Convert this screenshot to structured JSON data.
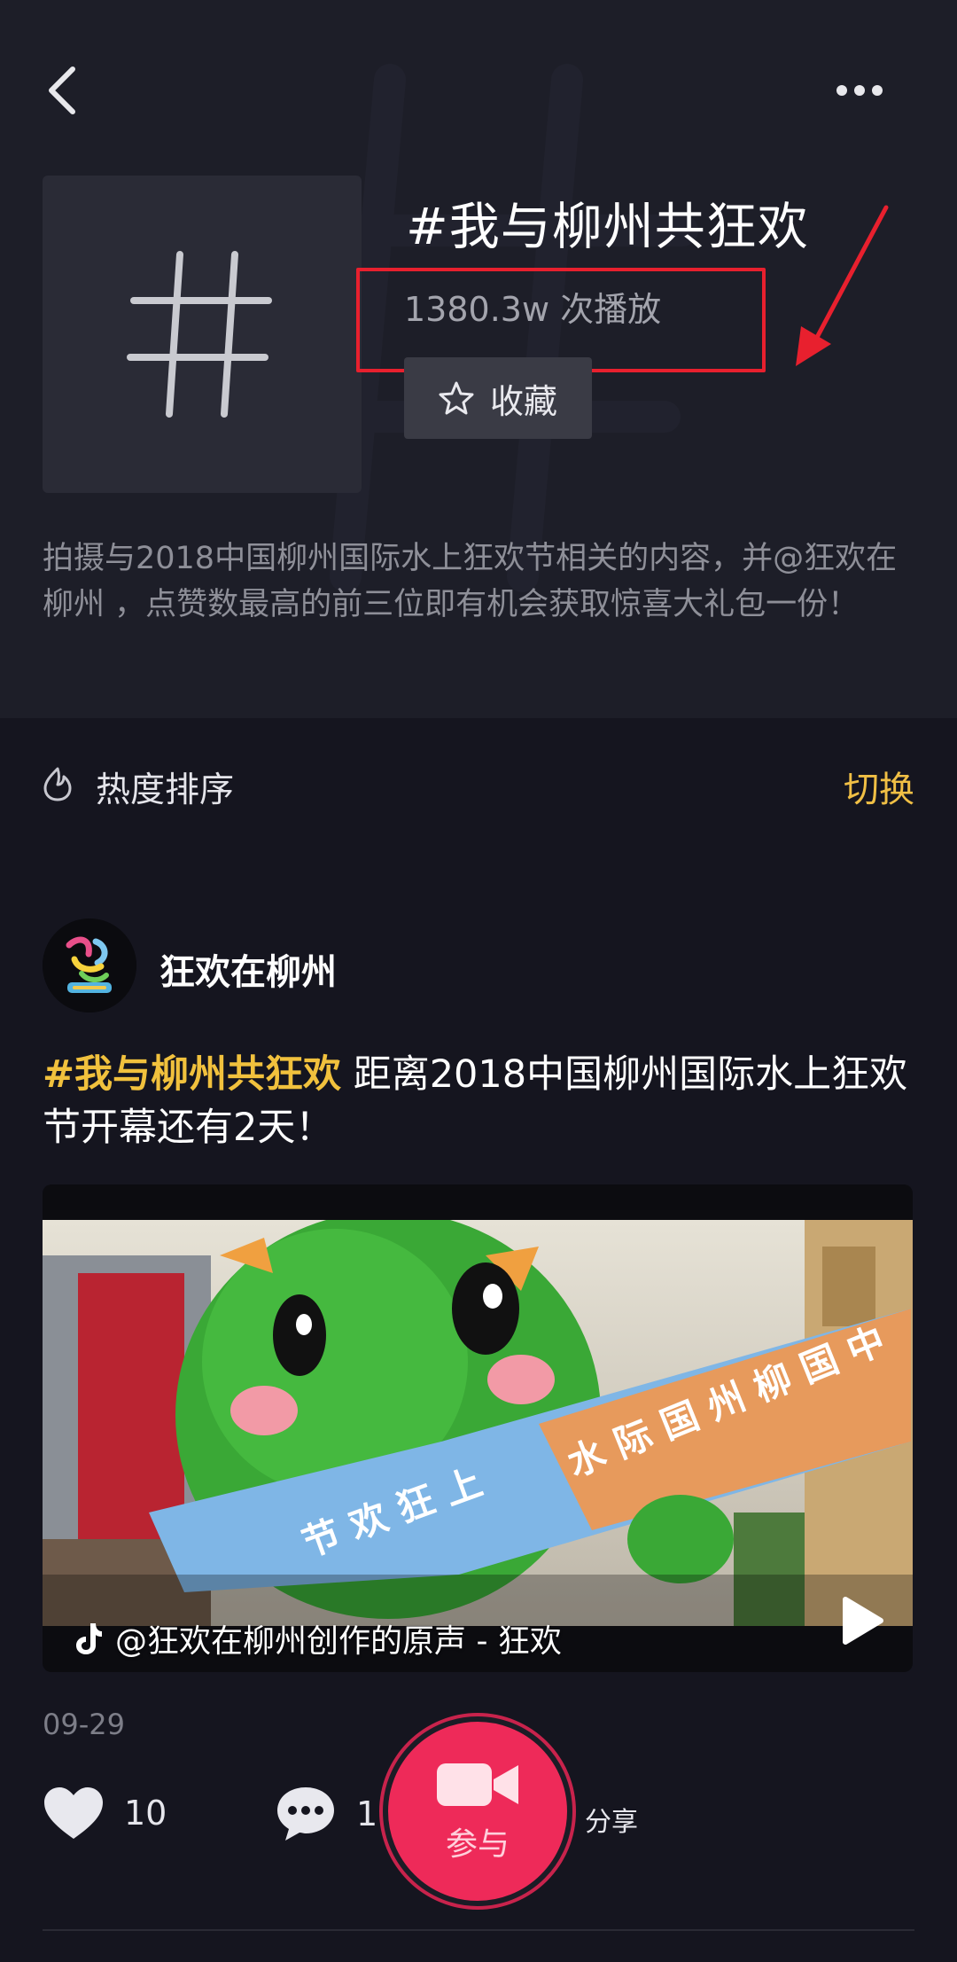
{
  "header": {
    "topic_title": "#我与柳州共狂欢",
    "play_count": "1380.3w 次播放",
    "collect_label": "收藏",
    "description": "拍摄与2018中国柳州国际水上狂欢节相关的内容，并@狂欢在柳州 ，点赞数最高的前三位即有机会获取惊喜大礼包一份！"
  },
  "sort": {
    "label": "热度排序",
    "switch_label": "切换"
  },
  "post": {
    "author": "狂欢在柳州",
    "caption_tag": "#我与柳州共狂欢",
    "caption_text": " 距离2018中国柳州国际水上狂欢节开幕还有2天！",
    "music": "@狂欢在柳州创作的原声 - 狂欢",
    "date": "09-29",
    "likes": "10",
    "comments": "1",
    "share_label": "分享"
  },
  "join_button": {
    "label": "参与"
  },
  "colors": {
    "background": "#15151f",
    "header_bg": "#1d1e28",
    "accent_yellow": "#f1c13d",
    "join_pink": "#ee2a59",
    "highlight_red": "#e8202e"
  },
  "icons": [
    "back-icon",
    "more-icon",
    "hashtag-icon",
    "star-icon",
    "flame-icon",
    "tiktok-note-icon",
    "play-icon",
    "heart-icon",
    "comment-icon",
    "video-camera-icon"
  ]
}
